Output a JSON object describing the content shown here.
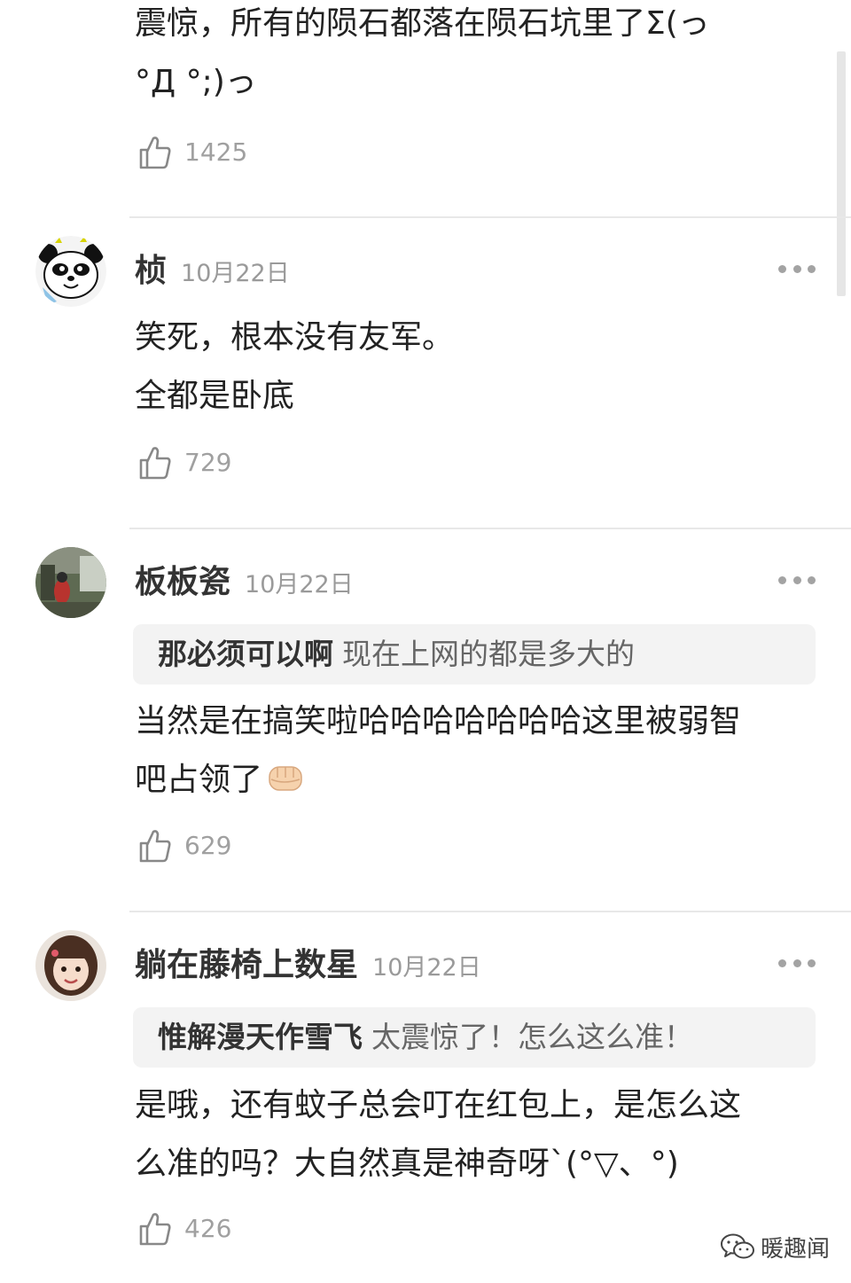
{
  "top_comment": {
    "text_lines": [
      "震惊，所有的陨石都落在陨石坑里了Σ(っ",
      "°Д °;)っ"
    ],
    "likes": "1425"
  },
  "comments": [
    {
      "username": "桢",
      "date": "10月22日",
      "avatar_icon": "panda-avatar-icon",
      "text_lines": [
        "笑死，根本没有友军。",
        "全都是卧底"
      ],
      "likes": "729"
    },
    {
      "username": "板板瓷",
      "date": "10月22日",
      "avatar_icon": "photo-avatar-icon",
      "reply": {
        "user": "那必须可以啊",
        "text": "现在上网的都是多大的"
      },
      "text_lines": [
        "当然是在搞笑啦哈哈哈哈哈哈哈这里被弱智",
        "吧占领了"
      ],
      "emoji": "fist-emoji-icon",
      "likes": "629"
    },
    {
      "username": "躺在藤椅上数星",
      "date": "10月22日",
      "avatar_icon": "girl-avatar-icon",
      "reply": {
        "user": "惟解漫天作雪飞",
        "text": "太震惊了！怎么这么准！"
      },
      "text_lines": [
        "是哦，还有蚊子总会叮在红包上，是怎么这",
        "么准的吗？大自然真是神奇呀`(°▽、°)"
      ],
      "likes": "426"
    }
  ],
  "watermark": {
    "text": "暖趣闻",
    "icon": "wechat-icon"
  },
  "colors": {
    "text": "#222222",
    "muted": "#9a9a9a",
    "reply_bg": "#f3f3f3",
    "divider": "#e8e8e8"
  }
}
